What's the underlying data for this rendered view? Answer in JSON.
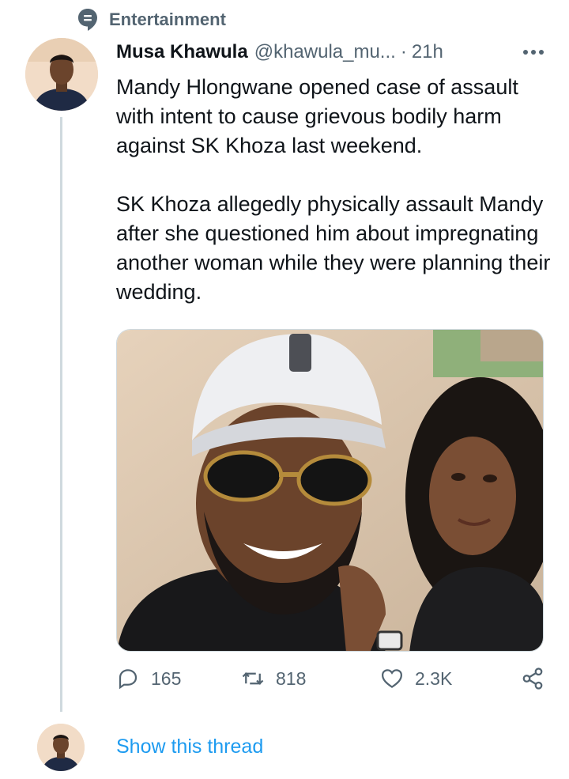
{
  "topic": {
    "label": "Entertainment",
    "icon": "topic-icon"
  },
  "tweet": {
    "author_name": "Musa Khawula",
    "handle": "@khawula_mu...",
    "separator": "·",
    "time": "21h",
    "more_icon": "more-icon",
    "text_paragraph_1": "Mandy Hlongwane opened case of assault with intent to cause grievous bodily harm against SK Khoza last weekend.",
    "text_paragraph_2": "SK Khoza allegedly physically assault Mandy after she questioned him about impregnating another woman while they were planning their wedding.",
    "media": {
      "type": "photo"
    }
  },
  "actions": {
    "reply": {
      "icon": "reply-icon",
      "count": "165"
    },
    "retweet": {
      "icon": "retweet-icon",
      "count": "818"
    },
    "like": {
      "icon": "heart-icon",
      "count": "2.3K"
    },
    "share": {
      "icon": "share-icon"
    }
  },
  "thread": {
    "show_label": "Show this thread"
  },
  "colors": {
    "accent": "#1d9bf0",
    "secondary_text": "#536471",
    "primary_text": "#0f1419",
    "divider": "#cfd9de"
  }
}
